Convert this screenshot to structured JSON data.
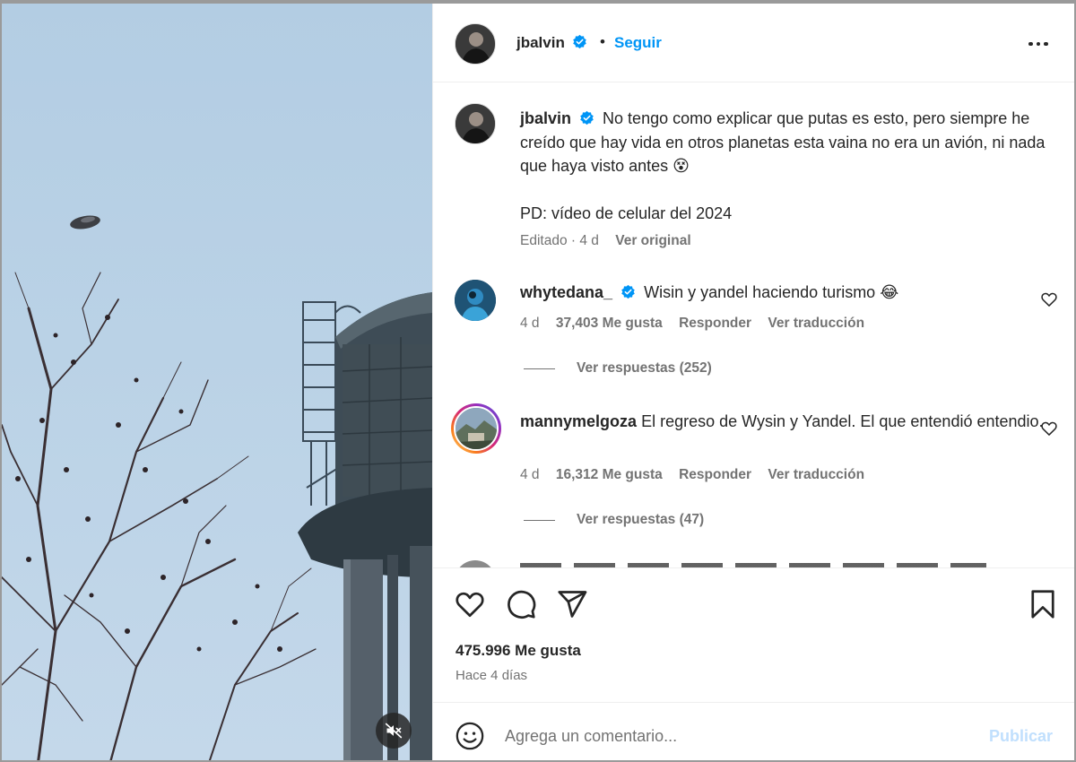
{
  "post": {
    "author": "jbalvin",
    "follow_label": "Seguir",
    "separator": "•"
  },
  "caption": {
    "username": "jbalvin",
    "text": "No tengo como explicar que putas es esto, pero siempre he creído que hay vida en otros planetas esta vaina no era un avión, ni nada que haya visto antes",
    "emoji": "😵",
    "ps": "PD: vídeo de celular del 2024",
    "edited": "Editado · 4 d",
    "see_original": "Ver original"
  },
  "comments": [
    {
      "username": "whytedana_",
      "verified": true,
      "text": "Wisin y yandel haciendo turismo",
      "emoji": "😂",
      "time": "4 d",
      "likes": "37,403 Me gusta",
      "reply_label": "Responder",
      "translate_label": "Ver traducción",
      "view_replies": "Ver respuestas (252)"
    },
    {
      "username": "mannymelgoza",
      "verified": false,
      "text": "El regreso de Wysin y Yandel. El que entendió entendio.",
      "time": "4 d",
      "likes": "16,312 Me gusta",
      "reply_label": "Responder",
      "translate_label": "Ver traducción",
      "view_replies": "Ver respuestas (47)"
    }
  ],
  "stats": {
    "likes": "475.996 Me gusta",
    "posted": "Hace 4 días"
  },
  "composer": {
    "placeholder": "Agrega un comentario...",
    "post_label": "Publicar"
  },
  "icons": {
    "verified": "verified-badge-icon",
    "more": "more-options-icon",
    "like": "heart-icon",
    "comment": "comment-icon",
    "share": "share-icon",
    "save": "bookmark-icon",
    "emoji": "emoji-icon",
    "mute": "muted-speaker-icon"
  },
  "colors": {
    "accent": "#0095f6",
    "verified": "#0095f6",
    "muted_text": "#737373",
    "post_disabled": "#c0dffd"
  }
}
